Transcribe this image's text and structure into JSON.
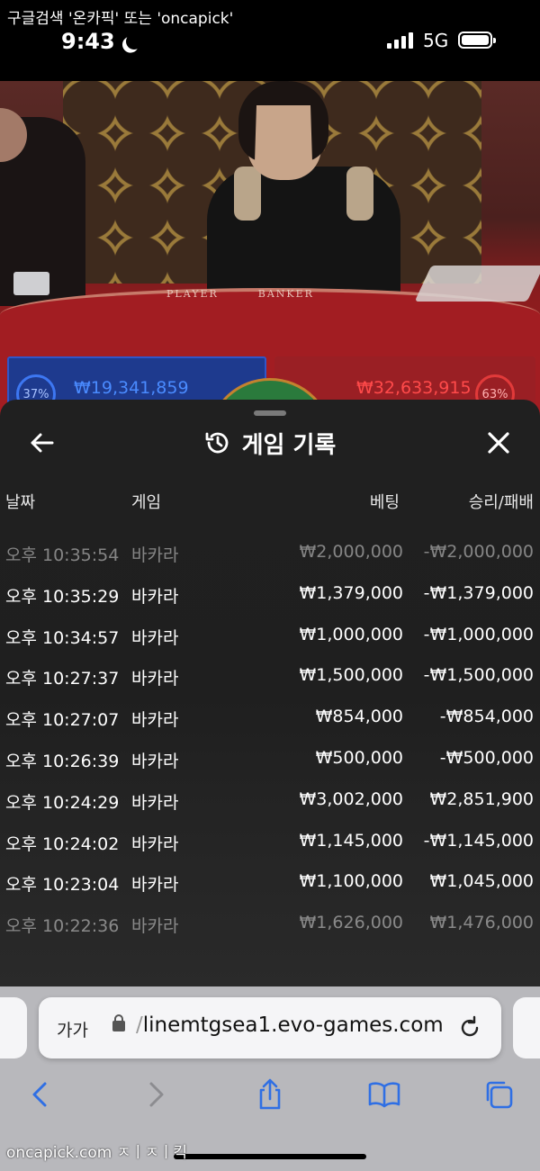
{
  "status_bar": {
    "watermark": "구글검색 '온카픽' 또는 'oncapick'",
    "time": "9:43",
    "network": "5G"
  },
  "video": {
    "table_text": "PLAYER        BANKER",
    "player_pct": "37%",
    "banker_pct": "63%",
    "player_amount": "₩19,341,859",
    "banker_amount": "₩32,633,915"
  },
  "sheet": {
    "title": "게임 기록",
    "columns": {
      "date": "날짜",
      "game": "게임",
      "bet": "베팅",
      "win_loss": "승리/패배"
    },
    "rows": [
      {
        "date": "오후 10:35:54",
        "game": "바카라",
        "bet": "₩2,000,000",
        "win_loss": "-₩2,000,000"
      },
      {
        "date": "오후 10:35:29",
        "game": "바카라",
        "bet": "₩1,379,000",
        "win_loss": "-₩1,379,000"
      },
      {
        "date": "오후 10:34:57",
        "game": "바카라",
        "bet": "₩1,000,000",
        "win_loss": "-₩1,000,000"
      },
      {
        "date": "오후 10:27:37",
        "game": "바카라",
        "bet": "₩1,500,000",
        "win_loss": "-₩1,500,000"
      },
      {
        "date": "오후 10:27:07",
        "game": "바카라",
        "bet": "₩854,000",
        "win_loss": "-₩854,000"
      },
      {
        "date": "오후 10:26:39",
        "game": "바카라",
        "bet": "₩500,000",
        "win_loss": "-₩500,000"
      },
      {
        "date": "오후 10:24:29",
        "game": "바카라",
        "bet": "₩3,002,000",
        "win_loss": "₩2,851,900"
      },
      {
        "date": "오후 10:24:02",
        "game": "바카라",
        "bet": "₩1,145,000",
        "win_loss": "-₩1,145,000"
      },
      {
        "date": "오후 10:23:04",
        "game": "바카라",
        "bet": "₩1,100,000",
        "win_loss": "₩1,045,000"
      },
      {
        "date": "오후 10:22:36",
        "game": "바카라",
        "bet": "₩1,626,000",
        "win_loss": "₩1,476,000"
      }
    ]
  },
  "browser": {
    "aa_label": "가가",
    "url_prefix": "/",
    "url": "linemtgsea1.evo-games.com"
  },
  "watermark_bottom": "oncapick.com ㅈㅣㅈㅣ킥"
}
